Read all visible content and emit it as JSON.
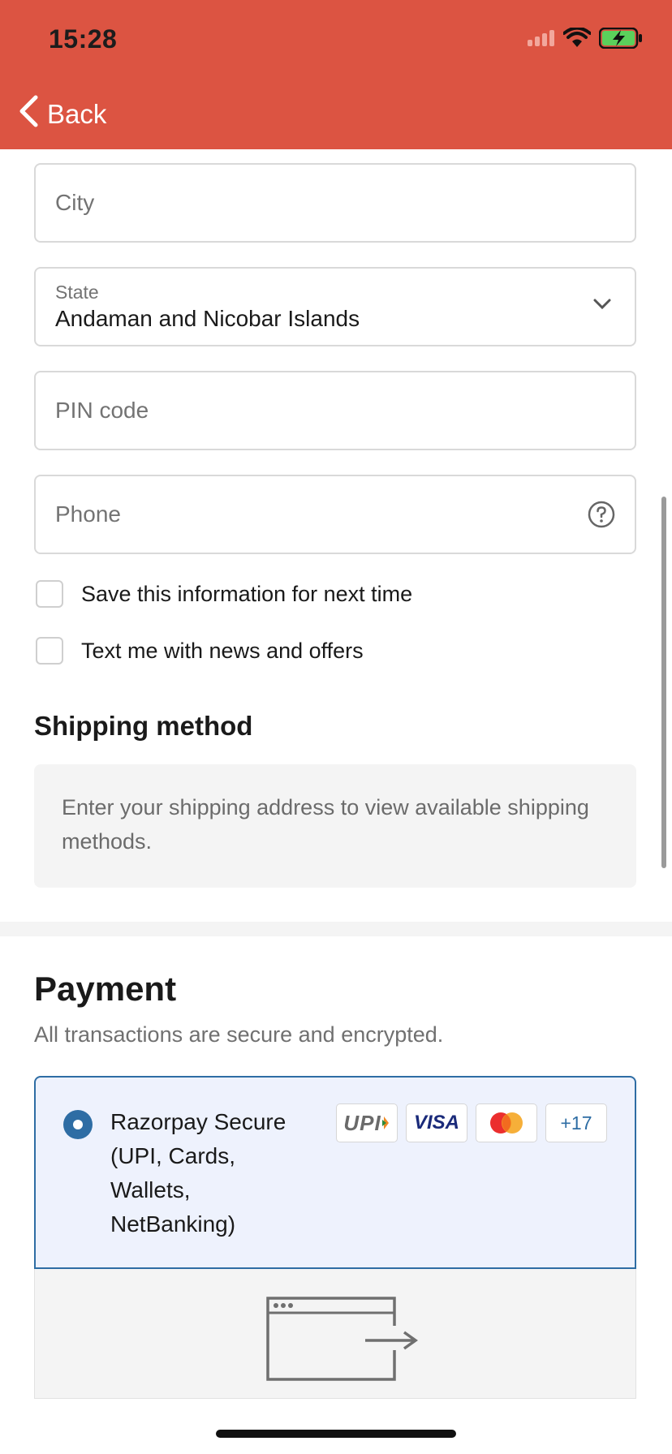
{
  "status_bar": {
    "time": "15:28"
  },
  "nav": {
    "back_label": "Back"
  },
  "form": {
    "city": {
      "placeholder": "City"
    },
    "state": {
      "label": "State",
      "value": "Andaman and Nicobar Islands"
    },
    "pin": {
      "placeholder": "PIN code"
    },
    "phone": {
      "placeholder": "Phone"
    },
    "save_info_label": "Save this information for next time",
    "text_offers_label": "Text me with news and offers"
  },
  "shipping": {
    "title": "Shipping method",
    "note": "Enter your shipping address to view available shipping methods."
  },
  "payment": {
    "title": "Payment",
    "subtitle": "All transactions are secure and encrypted.",
    "option_label": "Razorpay Secure (UPI, Cards, Wallets, NetBanking)",
    "badges": {
      "upi": "UPI",
      "visa": "VISA",
      "more": "+17"
    }
  },
  "colors": {
    "header": "#dc5442",
    "accent": "#2e6da4"
  }
}
